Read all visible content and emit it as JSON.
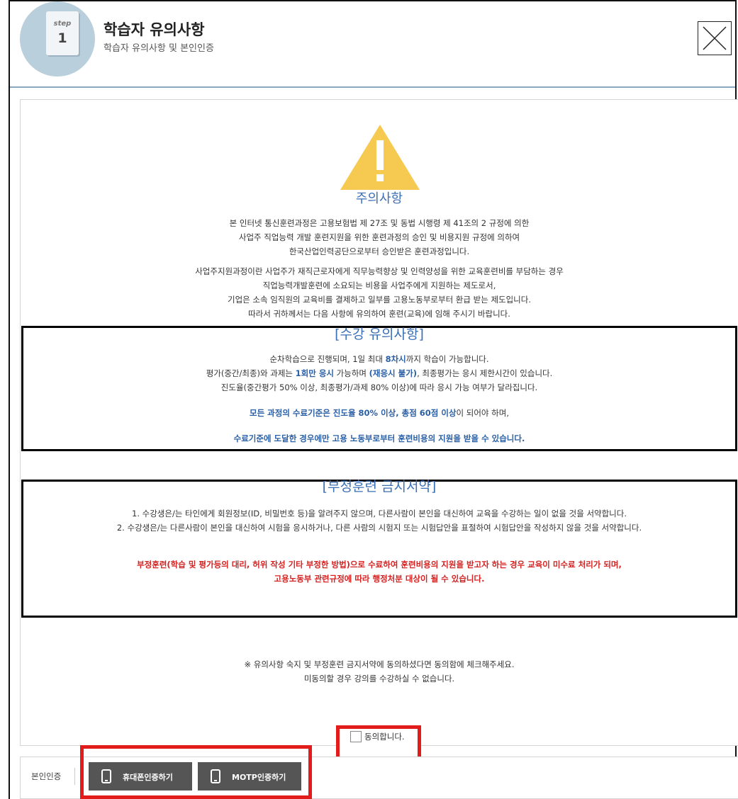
{
  "header": {
    "step_word": "step",
    "step_number": "1",
    "title": "학습자 유의사항",
    "subtitle": "학습자 유의사항 및 본인인증",
    "close_icon": "close-icon"
  },
  "notice": {
    "title": "주의사항",
    "para1": [
      "본 인터넷 통신훈련과정은 고용보험법 제 27조 및 동법 시행령 제 41조의 2 규정에 의한",
      "사업주 직업능력 개발 훈련지원을 위한 훈련과정의 승인 및 비용지원 규정에 의하여",
      "한국산업인력공단으로부터 승인받은 훈련과정입니다."
    ],
    "para2": [
      "사업주지원과정이란 사업주가 재직근로자에게 직무능력향상 및 인력양성을 위한 교육훈련비를 부담하는 경우",
      "직업능력개발훈련에 소요되는 비용을 사업주에게 지원하는 제도로서,",
      "기업은 소속 임직원의 교육비를 결제하고 일부를 고용노동부로부터 환급 받는 제도입니다.",
      "따라서 귀하께서는 다음 사항에 유의하여 훈련(교육)에 임해 주시기 바랍니다."
    ]
  },
  "course_notice": {
    "title": "[수강 유의사항]",
    "line1_a": "순차학습으로 진행되며, 1일 최대 ",
    "line1_b": "8차시",
    "line1_c": "까지 학습이 가능합니다.",
    "line2_a": "평가(중간/최종)와 과제는 ",
    "line2_b": "1회만 응시",
    "line2_c": " 가능하며 ",
    "line2_d": "(재응시 불가)",
    "line2_e": ", 최종평가는 응시 제한시간이 있습니다.",
    "line3": "진도율(중간평가 50% 이상, 최종평가/과제 80% 이상)에 따라 응시 가능 여부가 달라집니다.",
    "line4_a": "모든 과정의 수료기준은 진도율 80% 이상, 총점 60점 이상",
    "line4_b": "이 되어야 하며,",
    "line5": "수료기준에 도달한 경우에만 고용 노동부로부터 훈련비용의 지원을 받을 수 있습니다."
  },
  "pledge": {
    "title": "[부정훈련 금지서약]",
    "item1": "1. 수강생은/는 타인에게 회원정보(ID, 비밀번호 등)을 알려주지 않으며, 다른사람이 본인을 대신하여 교육을 수강하는 일이 없을 것을 서약합니다.",
    "item2": "2. 수강생은/는 다른사람이 본인을 대신하여 시험을 응시하거나, 다른 사람의 시험지 또는 시험답안을 표절하여 시험답안을 작성하지 않을 것을 서약합니다.",
    "warning1": "부정훈련(학습 및 평가등의 대리, 허위 작성 기타 부정한 방법)으로 수료하여 훈련비용의 지원을 받고자 하는 경우 교육이 미수료 처리가 되며,",
    "warning2": "고용노동부 관련규정에 따라 행정처분 대상이 될 수 있습니다."
  },
  "agreement": {
    "note1": "※ 유의사항 숙지 및 부정훈련 금지서약에 동의하셨다면 동의함에 체크해주세요.",
    "note2": "미동의할 경우 강의를 수강하실 수 없습니다.",
    "checkbox_label": "동의합니다.",
    "checked": false
  },
  "auth": {
    "label": "본인인증",
    "phone_button": "휴대폰인증하기",
    "motp_button": "MOTP인증하기",
    "icon": "phone-icon"
  },
  "colors": {
    "accent_blue": "#3b6fb6",
    "highlight_red": "#e21b1b",
    "warning_yellow": "#f6c950",
    "button_gray": "#555555"
  }
}
